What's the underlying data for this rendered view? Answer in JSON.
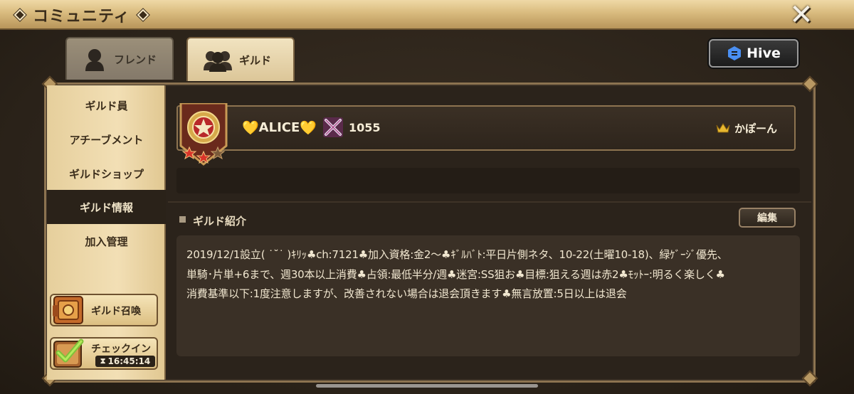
{
  "window": {
    "title": "コミュニティ",
    "close_glyph": "✕"
  },
  "tabs": [
    {
      "label": "フレンド",
      "icon": "friend-silhouette-icon",
      "active": false
    },
    {
      "label": "ギルド",
      "icon": "guild-silhouette-icon",
      "active": true
    }
  ],
  "hive": {
    "label": "Hive"
  },
  "sidebar": {
    "items": [
      {
        "label": "ギルド員"
      },
      {
        "label": "アチーブメント"
      },
      {
        "label": "ギルドショップ"
      },
      {
        "label": "ギルド情報",
        "active": true
      },
      {
        "label": "加入管理"
      }
    ],
    "summon_label": "ギルド召喚",
    "checkin_label": "チェックイン",
    "checkin_time": "16:45:14"
  },
  "guild": {
    "heart_left": "💛",
    "name": "ALICE",
    "heart_right": "💛",
    "score": "1055",
    "leader": "かぽーん",
    "stars": 3
  },
  "intro": {
    "title": "ギルド紹介",
    "edit_label": "編集",
    "text": "2019/12/1設立( ˙˘˙ )ｷﾘｯ♣ch:7121♣加入資格:金2〜♣ｷﾞﾙﾊﾞﾄ:平日片側ネタ、10-22(土曜10-18)、緑ｹﾞｰｼﾞ優先、\n単騎･片単+6まで、週30本以上消費♣占領:最低半分/週♣迷宮:SS狙お♣目標:狙える週は赤2♣ﾓｯﾄｰ:明るく楽しく♣\n消費基準以下:1度注意しますが、改善されない場合は退会頂きます♣無言放置:5日以上は退会"
  },
  "colors": {
    "title_bar": "#d9bb7e",
    "sidebar": "#f2dfb5",
    "panel": "#2b231b",
    "accent_gold": "#e6b433"
  }
}
